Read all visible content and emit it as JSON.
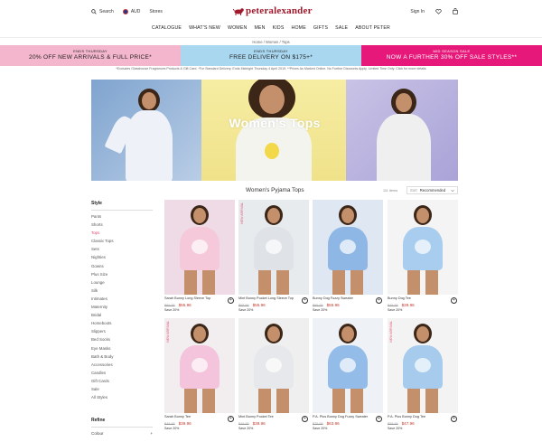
{
  "header": {
    "search_label": "Search",
    "currency_label": "AUD",
    "stores_label": "Stores",
    "logo_text": "peteralexander",
    "sign_in_label": "Sign In"
  },
  "nav": {
    "items": [
      "CATALOGUE",
      "WHAT'S NEW",
      "WOMEN",
      "MEN",
      "KIDS",
      "HOME",
      "GIFTS",
      "SALE",
      "ABOUT PETER"
    ]
  },
  "breadcrumb": "Home  /  Women  /  Tops",
  "promos": [
    {
      "small": "ENDS THURSDAY",
      "big": "20% OFF NEW ARRIVALS & FULL PRICE*",
      "bg": "#f4b6cc",
      "color": "#222"
    },
    {
      "small": "ENDS THURSDAY",
      "big": "FREE DELIVERY ON $175+*",
      "bg": "#a9d7f0",
      "color": "#222"
    },
    {
      "small": "MID SEASON SALE",
      "big": "NOW A FURTHER 30% OFF SALE STYLES**",
      "bg": "#e6197a",
      "color": "#fff"
    }
  ],
  "disclaimer": "*Excludes Glasshouse Fragrances Products & Gift Card. *For Standard Delivery. Ends Midnight Thursday 4 April 2019. **Prices As Marked Online. No Further Discounts Apply. Limited Time Only. Click for more details",
  "hero": {
    "title": "Women's Tops"
  },
  "sidebar": {
    "title": "Style",
    "items": [
      "Pants",
      "Shorts",
      "Tops",
      "Classic Tops",
      "Sets",
      "Nighties",
      "Gowns",
      "Plus Size",
      "Lounge",
      "Silk",
      "Intimates",
      "Maternity",
      "Bridal",
      "Homeboots",
      "Slippers",
      "Bed Socks",
      "Eye Masks",
      "Bath & Body",
      "Accessories",
      "Candles",
      "Gift Cards",
      "Sale",
      "All Styles"
    ],
    "active_index": 2,
    "refine_label": "Refine",
    "colour_label": "Colour",
    "colour_toggle": "+"
  },
  "products_header": {
    "title": "Women's Pyjama Tops",
    "count": "111 Items",
    "sort_label": "Sort",
    "sort_value": "Recommended"
  },
  "products": [
    {
      "name": "Sarah Bunny Long Sleeve Top",
      "was": "$69.95",
      "now": "$55.96",
      "save": "Save 20%",
      "new": false,
      "bg": "#eedbe6",
      "top": "#f6c9da"
    },
    {
      "name": "Mint Bunny Pocket Long Sleeve Top",
      "was": "$69.95",
      "now": "$55.96",
      "save": "Save 20%",
      "new": true,
      "new_label": "NEW ARRIVAL",
      "bg": "#e8ebee",
      "top": "#dfe3e8"
    },
    {
      "name": "Bunny Dog Fuzzy Sweater",
      "was": "$69.95",
      "now": "$55.96",
      "save": "Save 20%",
      "new": false,
      "bg": "#dfe8f2",
      "top": "#8fb7e6"
    },
    {
      "name": "Bunny Dog Tee",
      "was": "$49.95",
      "now": "$39.96",
      "save": "Save 20%",
      "new": false,
      "bg": "#f4f4f4",
      "top": "#a9cdee"
    },
    {
      "name": "Sarah Bunny Tee",
      "was": "$49.95",
      "now": "$39.96",
      "save": "Save 20%",
      "new": true,
      "new_label": "NEW ARRIVAL",
      "bg": "#f2eef0",
      "top": "#f4c4dc"
    },
    {
      "name": "Mint Bunny Pocket Tee",
      "was": "$49.95",
      "now": "$39.96",
      "save": "Save 20%",
      "new": false,
      "bg": "#efefef",
      "top": "#e6e8ec"
    },
    {
      "name": "P.A. Plus Bunny Dog Fuzzy Sweater",
      "was": "$79.95",
      "now": "$63.96",
      "save": "Save 20%",
      "new": false,
      "bg": "#eef2f6",
      "top": "#93bce8"
    },
    {
      "name": "P.A. Plus Bunny Dog Tee",
      "was": "$59.95",
      "now": "$47.96",
      "save": "Save 20%",
      "new": true,
      "new_label": "NEW ARRIVAL",
      "bg": "#f3f3f3",
      "top": "#a6cbec"
    }
  ],
  "colors": {
    "brand": "#a0182b",
    "accent_pink": "#d84a6e",
    "sale_red": "#c0392b"
  }
}
